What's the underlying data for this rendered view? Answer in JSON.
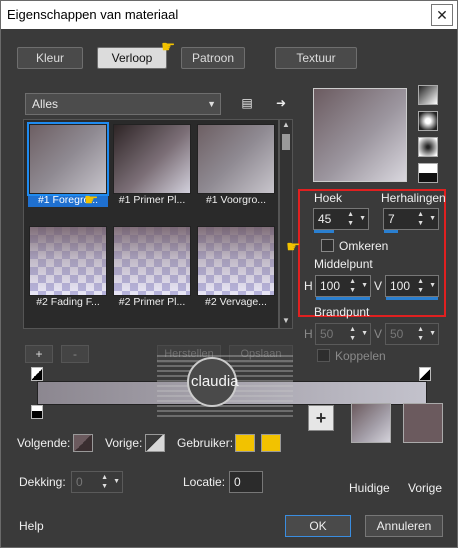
{
  "window": {
    "title": "Eigenschappen van materiaal",
    "close_glyph": "✕"
  },
  "tabs": [
    {
      "label": "Kleur",
      "active": false
    },
    {
      "label": "Verloop",
      "active": true
    },
    {
      "label": "Patroon",
      "active": false
    },
    {
      "label": "Textuur",
      "active": false
    }
  ],
  "gallery": {
    "filter": "Alles",
    "items": [
      {
        "label": "#1 Foregro...",
        "selected": true
      },
      {
        "label": "#1 Primer Pl...",
        "selected": false
      },
      {
        "label": "#1 Voorgro...",
        "selected": false
      },
      {
        "label": "#2 Fading F...",
        "selected": false
      },
      {
        "label": "#2 Primer Pl...",
        "selected": false
      },
      {
        "label": "#2 Vervage...",
        "selected": false
      }
    ]
  },
  "gradient_settings": {
    "angle_label": "Hoek",
    "angle_value": "45",
    "repeats_label": "Herhalingen",
    "repeats_value": "7",
    "invert_label": "Omkeren",
    "center_label": "Middelpunt",
    "center_h_label": "H",
    "center_h_value": "100",
    "center_v_label": "V",
    "center_v_value": "100",
    "focus_label": "Brandpunt",
    "focus_h_label": "H",
    "focus_h_value": "50",
    "focus_v_label": "V",
    "focus_v_value": "50",
    "link_label": "Koppelen"
  },
  "editor": {
    "add_label": "+",
    "remove_label": "-",
    "save_label": "Herstellen",
    "delete_label": "Opslaan"
  },
  "watermark": {
    "text": "claudia"
  },
  "bottom_panel": {
    "next_label": "Volgende:",
    "prev_label": "Vorige:",
    "user_label": "Gebruiker:",
    "opacity_label": "Dekking:",
    "opacity_value": "0",
    "location_label": "Locatie:",
    "location_value": "0",
    "current_label": "Huidige",
    "previous_label": "Vorige"
  },
  "footer": {
    "help_label": "Help",
    "ok_label": "OK",
    "cancel_label": "Annuleren"
  },
  "colors": {
    "foreground": "#6b5a5e",
    "background": "#cfcdd6",
    "user_swatch": "#f2c200",
    "selection_blue": "#1f8bf0",
    "highlight_red": "#e02020"
  }
}
